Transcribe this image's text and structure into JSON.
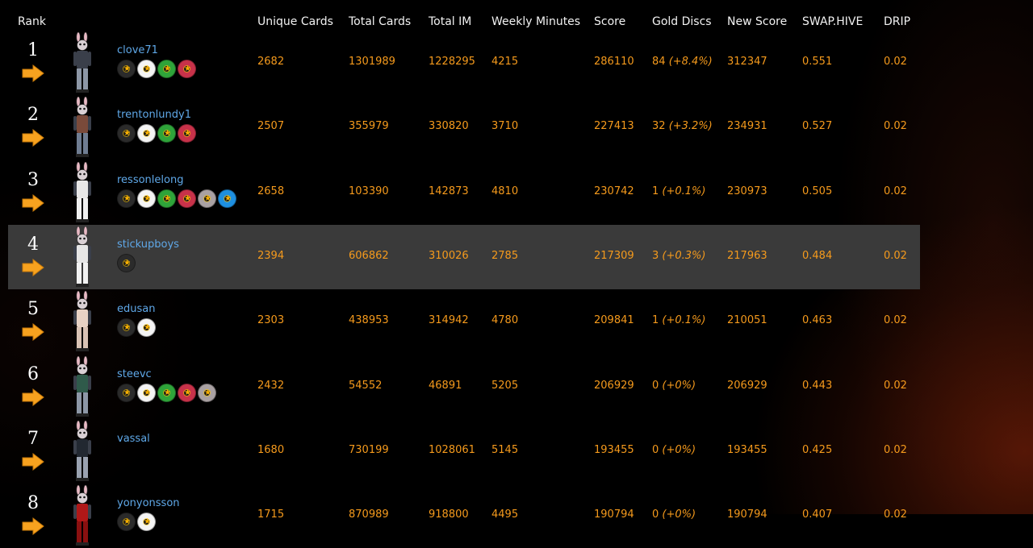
{
  "headers": {
    "rank": "Rank",
    "unique_cards": "Unique Cards",
    "total_cards": "Total Cards",
    "total_im": "Total IM",
    "weekly_minutes": "Weekly Minutes",
    "score": "Score",
    "gold_discs": "Gold Discs",
    "new_score": "New Score",
    "swap_hive": "SWAP.HIVE",
    "drip": "DRIP"
  },
  "disc_colors": {
    "black": "#2b2b2b",
    "white": "#f4f4f4",
    "green": "#2fa43a",
    "red": "#c8324a",
    "silver": "#a9a1a3",
    "blue": "#1e8fe0"
  },
  "rows": [
    {
      "rank": "1",
      "username": "clove71",
      "discs": [
        "black",
        "white",
        "green",
        "red"
      ],
      "unique_cards": "2682",
      "total_cards": "1301989",
      "total_im": "1228295",
      "weekly_minutes": "4215",
      "score": "286110",
      "gold_count": "84",
      "gold_pct": "(+8.4%)",
      "new_score": "312347",
      "swap_hive": "0.551",
      "drip": "0.02",
      "highlight": false
    },
    {
      "rank": "2",
      "username": "trentonlundy1",
      "discs": [
        "black",
        "white",
        "green",
        "red"
      ],
      "unique_cards": "2507",
      "total_cards": "355979",
      "total_im": "330820",
      "weekly_minutes": "3710",
      "score": "227413",
      "gold_count": "32",
      "gold_pct": "(+3.2%)",
      "new_score": "234931",
      "swap_hive": "0.527",
      "drip": "0.02",
      "highlight": false
    },
    {
      "rank": "3",
      "username": "ressonlelong",
      "discs": [
        "black",
        "white",
        "green",
        "red",
        "silver",
        "blue"
      ],
      "unique_cards": "2658",
      "total_cards": "103390",
      "total_im": "142873",
      "weekly_minutes": "4810",
      "score": "230742",
      "gold_count": "1",
      "gold_pct": "(+0.1%)",
      "new_score": "230973",
      "swap_hive": "0.505",
      "drip": "0.02",
      "highlight": false
    },
    {
      "rank": "4",
      "username": "stickupboys",
      "discs": [
        "black"
      ],
      "unique_cards": "2394",
      "total_cards": "606862",
      "total_im": "310026",
      "weekly_minutes": "2785",
      "score": "217309",
      "gold_count": "3",
      "gold_pct": "(+0.3%)",
      "new_score": "217963",
      "swap_hive": "0.484",
      "drip": "0.02",
      "highlight": true
    },
    {
      "rank": "5",
      "username": "edusan",
      "discs": [
        "black",
        "white"
      ],
      "unique_cards": "2303",
      "total_cards": "438953",
      "total_im": "314942",
      "weekly_minutes": "4780",
      "score": "209841",
      "gold_count": "1",
      "gold_pct": "(+0.1%)",
      "new_score": "210051",
      "swap_hive": "0.463",
      "drip": "0.02",
      "highlight": false
    },
    {
      "rank": "6",
      "username": "steevc",
      "discs": [
        "black",
        "white",
        "green",
        "red",
        "silver"
      ],
      "unique_cards": "2432",
      "total_cards": "54552",
      "total_im": "46891",
      "weekly_minutes": "5205",
      "score": "206929",
      "gold_count": "0",
      "gold_pct": "(+0%)",
      "new_score": "206929",
      "swap_hive": "0.443",
      "drip": "0.02",
      "highlight": false
    },
    {
      "rank": "7",
      "username": "vassal",
      "discs": [],
      "unique_cards": "1680",
      "total_cards": "730199",
      "total_im": "1028061",
      "weekly_minutes": "5145",
      "score": "193455",
      "gold_count": "0",
      "gold_pct": "(+0%)",
      "new_score": "193455",
      "swap_hive": "0.425",
      "drip": "0.02",
      "highlight": false
    },
    {
      "rank": "8",
      "username": "yonyonsson",
      "discs": [
        "black",
        "white"
      ],
      "unique_cards": "1715",
      "total_cards": "870989",
      "total_im": "918800",
      "weekly_minutes": "4495",
      "score": "190794",
      "gold_count": "0",
      "gold_pct": "(+0%)",
      "new_score": "190794",
      "swap_hive": "0.407",
      "drip": "0.02",
      "highlight": false
    }
  ]
}
